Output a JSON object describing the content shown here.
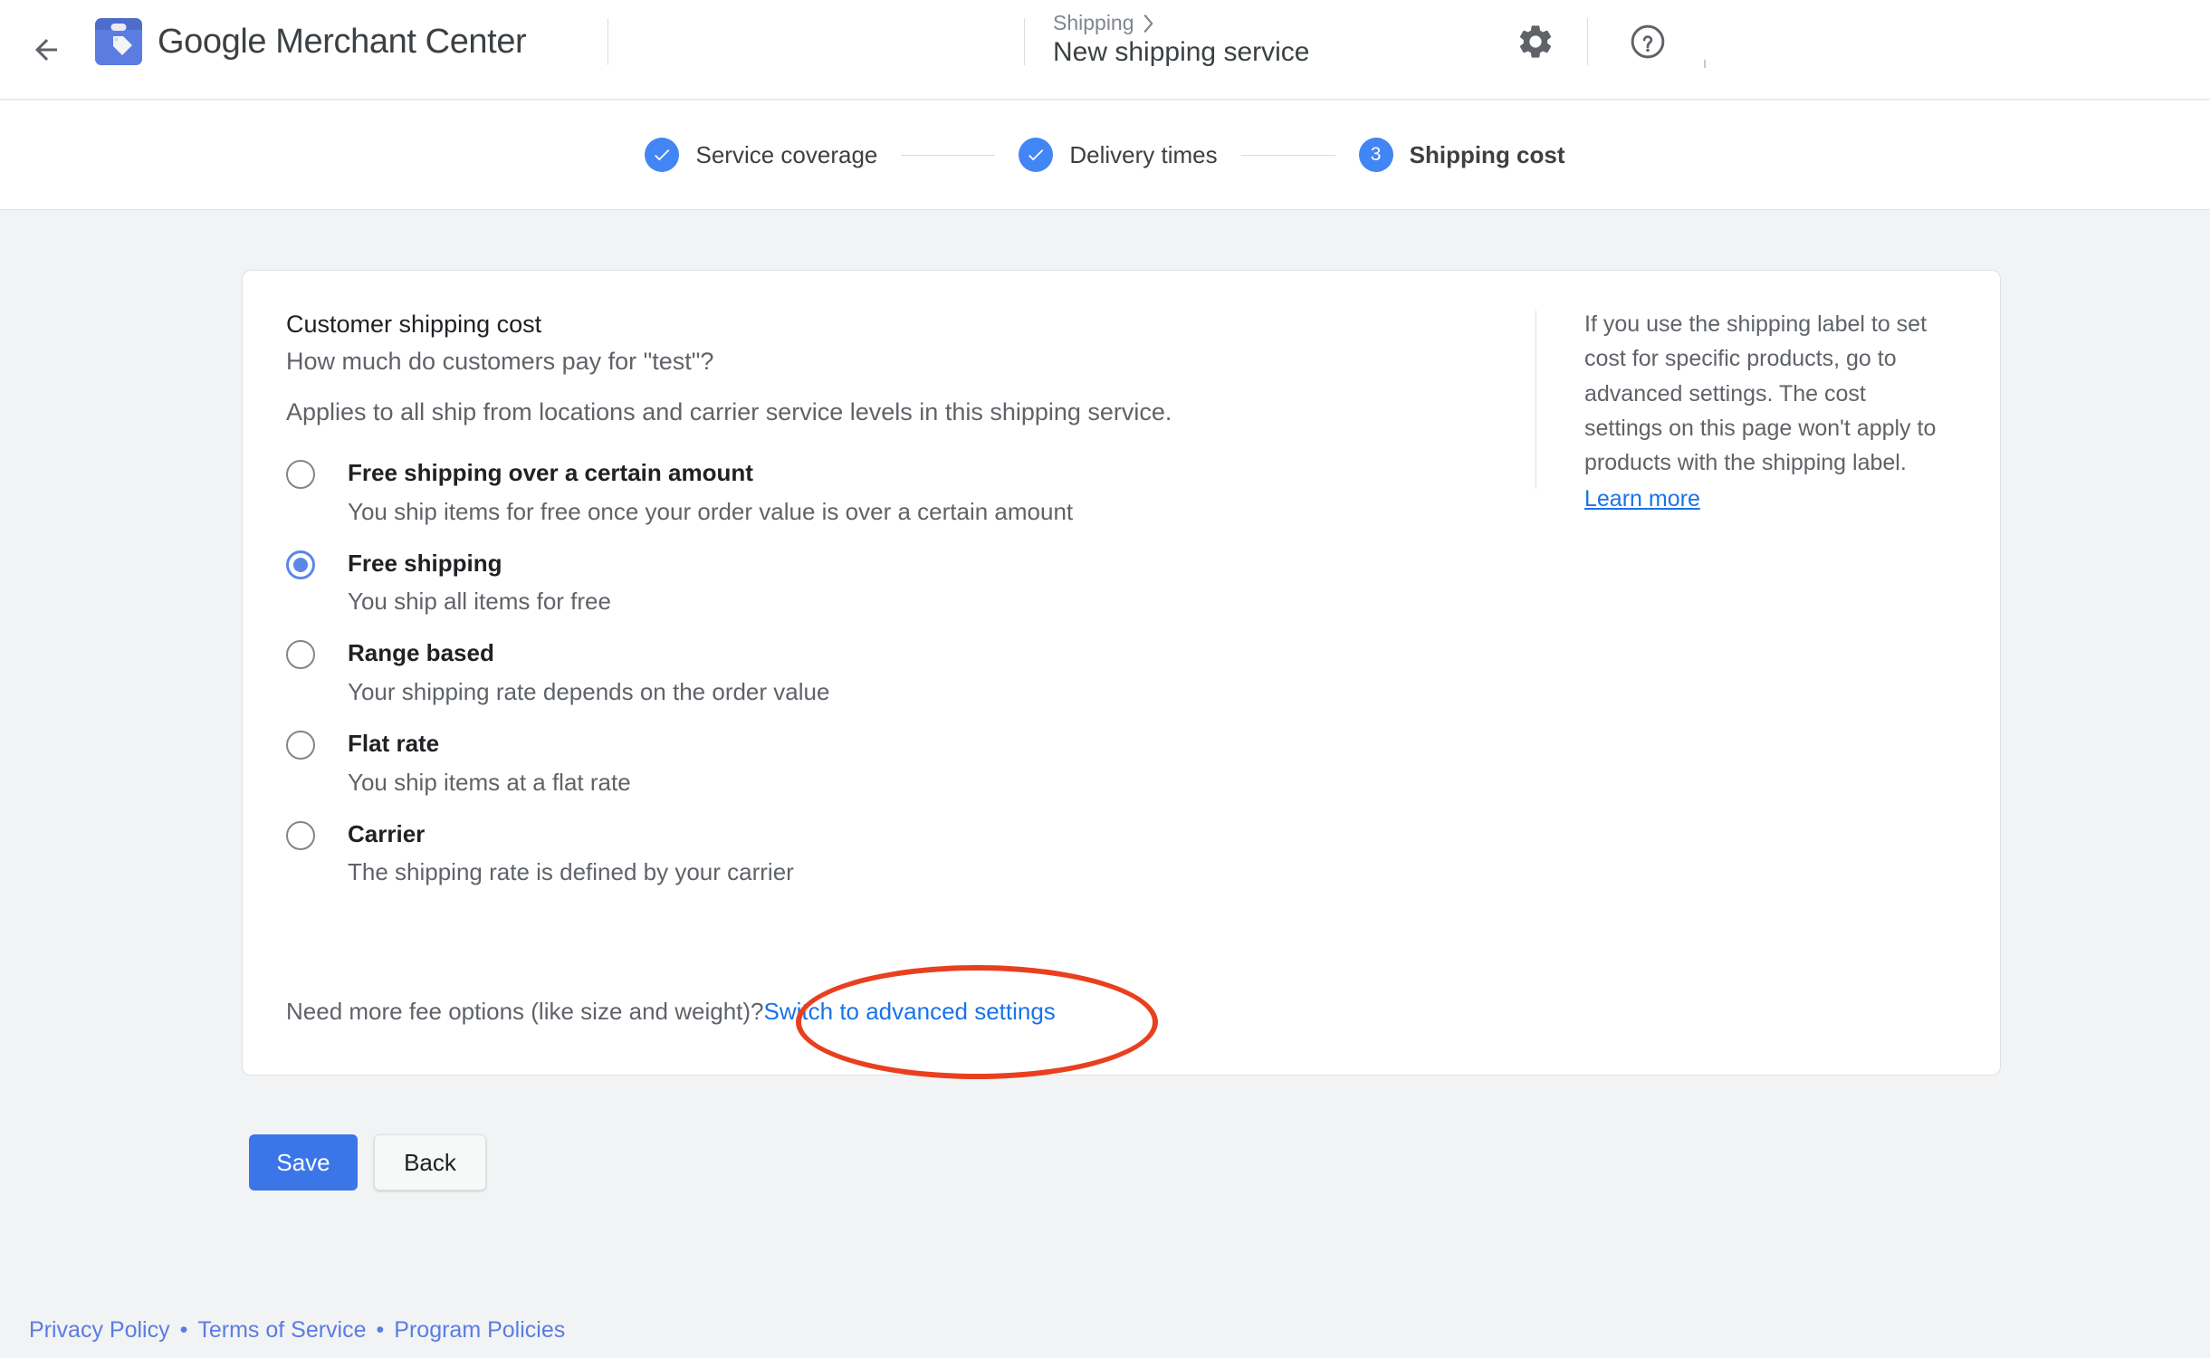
{
  "appbar": {
    "back_icon": "back-arrow-icon",
    "logo_icon": "merchant-center-logo-icon",
    "brand_name": "Google Merchant Center",
    "breadcrumb_parent": "Shipping",
    "breadcrumb_chevron": "›",
    "breadcrumb_current": "New shipping service",
    "gear_icon": "gear-icon",
    "help_icon": "help-icon"
  },
  "stepper": {
    "steps": [
      {
        "label": "Service coverage",
        "marker": "✓",
        "state": "complete"
      },
      {
        "label": "Delivery times",
        "marker": "✓",
        "state": "complete"
      },
      {
        "label": "Shipping cost",
        "marker": "3",
        "state": "current"
      }
    ]
  },
  "card": {
    "title": "Customer shipping cost",
    "subtitle": "How much do customers pay for \"test\"?",
    "description": "Applies to all ship from locations and carrier service levels in this shipping service.",
    "options": [
      {
        "label": "Free shipping over a certain amount",
        "hint": "You ship items for free once your order value is over a certain amount",
        "selected": false
      },
      {
        "label": "Free shipping",
        "hint": "You ship all items for free",
        "selected": true
      },
      {
        "label": "Range based",
        "hint": "Your shipping rate depends on the order value",
        "selected": false
      },
      {
        "label": "Flat rate",
        "hint": "You ship items at a flat rate",
        "selected": false
      },
      {
        "label": "Carrier",
        "hint": "The shipping rate is defined by your carrier",
        "selected": false
      }
    ],
    "fee_question": "Need more fee options (like size and weight)?",
    "fee_link": "Switch to advanced settings",
    "side_note": "If you use the shipping label to set cost for specific products, go to advanced settings. The cost settings on this page won't apply to products with the shipping label. ",
    "side_link": "Learn more"
  },
  "actions": {
    "save_label": "Save",
    "back_label": "Back"
  },
  "footer": {
    "privacy": "Privacy Policy",
    "terms": "Terms of Service",
    "program": "Program Policies",
    "separator": "•"
  },
  "annotation": {
    "shape": "ellipse-highlight",
    "color": "#e8401f",
    "targets": "Switch to advanced settings"
  },
  "colors": {
    "accent_blue": "#4285f4",
    "link_blue": "#1a73e8",
    "primary_button": "#3b76e8",
    "page_background": "#f1f3f4",
    "text_primary": "#202124",
    "text_secondary": "#5f6368",
    "annotation_red": "#e8401f"
  }
}
